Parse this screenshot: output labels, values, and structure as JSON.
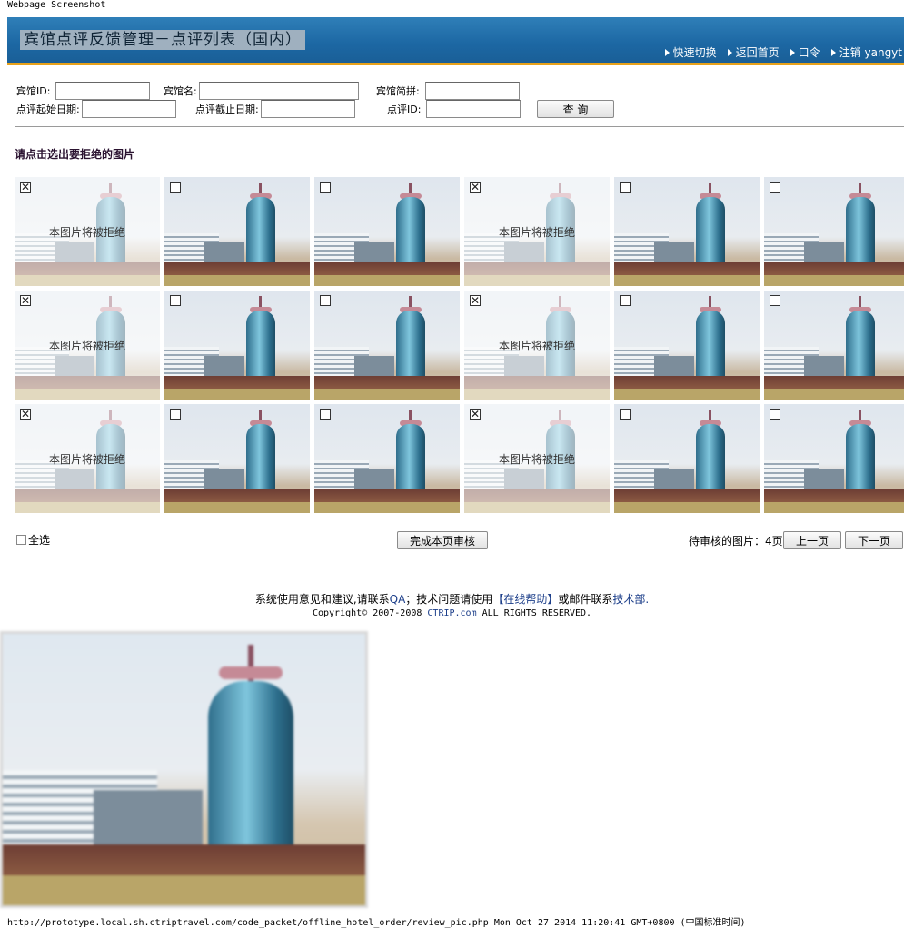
{
  "page_caption": "Webpage Screenshot",
  "banner": {
    "title": "宾馆点评反馈管理－点评列表（国内）",
    "nav": [
      "快速切换",
      "返回首页",
      "口令",
      "注销 yangyt"
    ]
  },
  "search": {
    "hotel_id_label": "宾馆ID:",
    "hotel_id_value": "",
    "hotel_name_label": "宾馆名:",
    "hotel_name_value": "",
    "hotel_pinyin_label": "宾馆简拼:",
    "hotel_pinyin_value": "",
    "start_date_label": "点评起始日期:",
    "start_date_value": "",
    "end_date_label": "点评截止日期:",
    "end_date_value": "",
    "review_id_label": "点评ID:",
    "review_id_value": "",
    "query_button": "查 询"
  },
  "instruction": "请点击选出要拒绝的图片",
  "reject_overlay_text": "本图片将被拒绝",
  "photos": [
    {
      "checked": true
    },
    {
      "checked": false
    },
    {
      "checked": false
    },
    {
      "checked": true
    },
    {
      "checked": false
    },
    {
      "checked": false
    },
    {
      "checked": true
    },
    {
      "checked": false
    },
    {
      "checked": false
    },
    {
      "checked": true
    },
    {
      "checked": false
    },
    {
      "checked": false
    },
    {
      "checked": true
    },
    {
      "checked": false
    },
    {
      "checked": false
    },
    {
      "checked": true
    },
    {
      "checked": false
    },
    {
      "checked": false
    }
  ],
  "bottom": {
    "select_all_label": "全选",
    "complete_button": "完成本页审核",
    "pending_text": "待审核的图片：4页",
    "prev_button": "上一页",
    "next_button": "下一页"
  },
  "footer": {
    "part1": "系统使用意见和建议,请联系",
    "qa_link": "QA",
    "part2": "；技术问题请使用",
    "help_link": "【在线帮助】",
    "part3": "或邮件联系",
    "tech_link": "技术部.",
    "copyright_prefix": "Copyright© 2007-2008 ",
    "copyright_link": "CTRIP.com",
    "copyright_suffix": " ALL RIGHTS RESERVED."
  },
  "url_line": "http://prototype.local.sh.ctriptravel.com/code_packet/offline_hotel_order/review_pic.php Mon Oct 27 2014 11:20:41 GMT+0800 (中国标准时间)"
}
